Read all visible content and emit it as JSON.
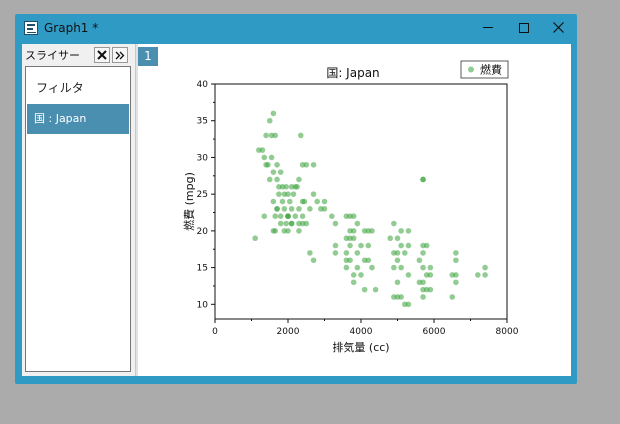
{
  "window": {
    "title": "Graph1 *",
    "accent_color": "#2f9ac3",
    "buttons": {
      "minimize": "minimize-icon",
      "maximize": "maximize-icon",
      "close": "close-icon"
    }
  },
  "slicer": {
    "title": "スライサー",
    "filter_label": "フィルタ",
    "item_label": "国 : Japan",
    "selected_color": "#4a8fb0"
  },
  "graph": {
    "layer_label": "1"
  },
  "chart_data": {
    "type": "scatter",
    "title": "国: Japan",
    "xlabel": "排気量 (cc)",
    "ylabel": "燃費 (mpg)",
    "xlim": [
      0,
      8000
    ],
    "ylim": [
      8,
      40
    ],
    "xticks": [
      0,
      2000,
      4000,
      6000,
      8000
    ],
    "yticks": [
      10,
      15,
      20,
      25,
      30,
      35,
      40
    ],
    "legend": "top-right",
    "grid": false,
    "point_color": "#3aa23a",
    "series": [
      {
        "name": "燃費",
        "x": [
          1500,
          1600,
          1400,
          1550,
          1650,
          1300,
          1200,
          1350,
          1450,
          1700,
          1550,
          1800,
          1600,
          1500,
          1700,
          1750,
          1850,
          1400,
          1950,
          2100,
          2200,
          2300,
          2400,
          2500,
          2700,
          2350,
          1750,
          1900,
          2000,
          2150,
          2250,
          2450,
          1600,
          1850,
          2050,
          2400,
          1700,
          1900,
          2100,
          2300,
          2600,
          2800,
          1650,
          1800,
          2000,
          2200,
          2400,
          1600,
          1800,
          1950,
          2100,
          2300,
          2500,
          1650,
          1900,
          2000,
          1350,
          1700,
          2000,
          2300,
          3000,
          2900,
          2000,
          2100,
          2400,
          2700,
          1100,
          2600,
          2700,
          3000,
          3200,
          3300,
          3600,
          3700,
          3800,
          3900,
          3800,
          3700,
          3600,
          4100,
          4200,
          4300,
          3300,
          3600,
          3700,
          3800,
          4000,
          4200,
          3300,
          3600,
          3700,
          3900,
          3700,
          3900,
          4100,
          4200,
          4300,
          3600,
          3800,
          4000,
          3800,
          4100,
          4400,
          4900,
          5000,
          5100,
          5200,
          5300,
          5000,
          4900,
          5100,
          5300,
          4900,
          5000,
          5100,
          5300,
          5000,
          5300,
          4800,
          5100,
          4900,
          5000,
          5200,
          5700,
          5800,
          5700,
          5600,
          5900,
          5700,
          5800,
          5900,
          5700,
          5600,
          5900,
          5700,
          5800,
          5700,
          6600,
          6600,
          6500,
          6600,
          6600,
          6500,
          7200,
          7400,
          7400,
          5700,
          5700
        ],
        "y": [
          35,
          36,
          33,
          33,
          33,
          31,
          31,
          30,
          29,
          29,
          30,
          28,
          28,
          27,
          27,
          26,
          26,
          29,
          26,
          26,
          26,
          27,
          29,
          29,
          29,
          33,
          25,
          25,
          25,
          25,
          26,
          24,
          24,
          24,
          24,
          24,
          23,
          23,
          23,
          23,
          23,
          24,
          22,
          22,
          22,
          22,
          22,
          20,
          21,
          21,
          21,
          21,
          21,
          20,
          20,
          20,
          22,
          23,
          22,
          20,
          24,
          23,
          22,
          21,
          21,
          25,
          19,
          17,
          16,
          23,
          22,
          21,
          22,
          22,
          22,
          21,
          20,
          20,
          19,
          20,
          20,
          20,
          18,
          17,
          19,
          19,
          18,
          18,
          17,
          16,
          18,
          17,
          16,
          15,
          16,
          16,
          15,
          15,
          14,
          14,
          13,
          12,
          12,
          11,
          11,
          11,
          10,
          10,
          13,
          15,
          15,
          14,
          17,
          16,
          18,
          18,
          19,
          20,
          19,
          20,
          21,
          17,
          17,
          18,
          18,
          17,
          16,
          15,
          15,
          14,
          14,
          13,
          13,
          12,
          12,
          12,
          11,
          17,
          16,
          14,
          14,
          13,
          11,
          14,
          15,
          14,
          27,
          27
        ]
      }
    ]
  }
}
